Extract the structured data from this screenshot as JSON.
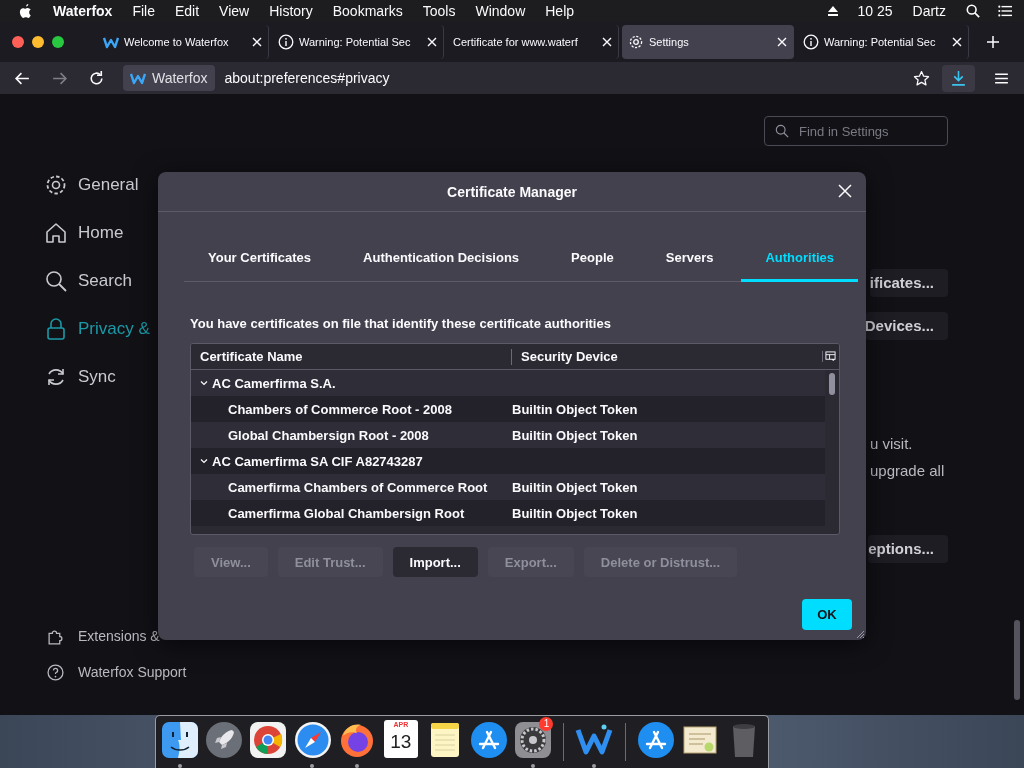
{
  "menubar": {
    "app": "Waterfox",
    "menus": [
      "File",
      "Edit",
      "View",
      "History",
      "Bookmarks",
      "Tools",
      "Window",
      "Help"
    ],
    "clock": "10 25",
    "user": "Dartz"
  },
  "tabs": [
    {
      "title": "Welcome to Waterfox",
      "selected": false
    },
    {
      "title": "Warning: Potential Sec",
      "selected": false
    },
    {
      "title": "Certificate for www.waterf",
      "selected": false
    },
    {
      "title": "Settings",
      "selected": true
    },
    {
      "title": "Warning: Potential Sec",
      "selected": false
    }
  ],
  "toolbar": {
    "forward_disabled": true,
    "identity": "Waterfox",
    "url": "about:preferences#privacy"
  },
  "settings": {
    "search": {
      "placeholder": "Find in Settings"
    },
    "nav": [
      {
        "label": "General",
        "selected": false
      },
      {
        "label": "Home",
        "selected": false
      },
      {
        "label": "Search",
        "selected": false
      },
      {
        "label": "Privacy &",
        "selected": true
      },
      {
        "label": "Sync",
        "selected": false
      }
    ],
    "footer": [
      "Extensions &",
      "Waterfox Support"
    ],
    "behind": [
      {
        "kind": "button",
        "text": "ificates..."
      },
      {
        "kind": "button",
        "text": "Devices..."
      },
      {
        "kind": "text",
        "text": "u visit."
      },
      {
        "kind": "text",
        "text": "upgrade all"
      },
      {
        "kind": "button",
        "text": "eptions..."
      }
    ]
  },
  "dialog": {
    "title": "Certificate Manager",
    "tabs": [
      {
        "label": "Your Certificates",
        "selected": false
      },
      {
        "label": "Authentication Decisions",
        "selected": false
      },
      {
        "label": "People",
        "selected": false
      },
      {
        "label": "Servers",
        "selected": false
      },
      {
        "label": "Authorities",
        "selected": true
      }
    ],
    "description": "You have certificates on file that identify these certificate authorities",
    "columns": [
      "Certificate Name",
      "Security Device"
    ],
    "rows": [
      {
        "name": "AC Camerfirma S.A.",
        "expanded": true,
        "children": [
          {
            "name": "Chambers of Commerce Root - 2008",
            "device": "Builtin Object Token"
          },
          {
            "name": "Global Chambersign Root - 2008",
            "device": "Builtin Object Token"
          }
        ]
      },
      {
        "name": "AC Camerfirma SA CIF A82743287",
        "expanded": true,
        "children": [
          {
            "name": "Camerfirma Chambers of Commerce Root",
            "device": "Builtin Object Token"
          },
          {
            "name": "Camerfirma Global Chambersign Root",
            "device": "Builtin Object Token"
          }
        ]
      }
    ],
    "buttons": [
      {
        "label": "View...",
        "disabled": true
      },
      {
        "label": "Edit Trust...",
        "disabled": true
      },
      {
        "label": "Import...",
        "disabled": false
      },
      {
        "label": "Export...",
        "disabled": true
      },
      {
        "label": "Delete or Distrust...",
        "disabled": true
      }
    ],
    "ok": "OK"
  },
  "dock": [
    {
      "kind": "finder",
      "running": true
    },
    {
      "kind": "launchpad",
      "running": false
    },
    {
      "kind": "chrome",
      "running": false
    },
    {
      "kind": "safari",
      "running": true
    },
    {
      "kind": "firefox",
      "running": true
    },
    {
      "kind": "calendar",
      "month": "APR",
      "day": "13",
      "running": false
    },
    {
      "kind": "notes",
      "running": false
    },
    {
      "kind": "appstore",
      "running": false
    },
    {
      "kind": "sysprefs",
      "badge": "1",
      "running": true
    },
    {
      "kind": "separator"
    },
    {
      "kind": "waterfox",
      "running": true
    },
    {
      "kind": "separator"
    },
    {
      "kind": "appstore",
      "running": false
    },
    {
      "kind": "certificate",
      "running": false
    },
    {
      "kind": "trash",
      "running": false
    }
  ]
}
